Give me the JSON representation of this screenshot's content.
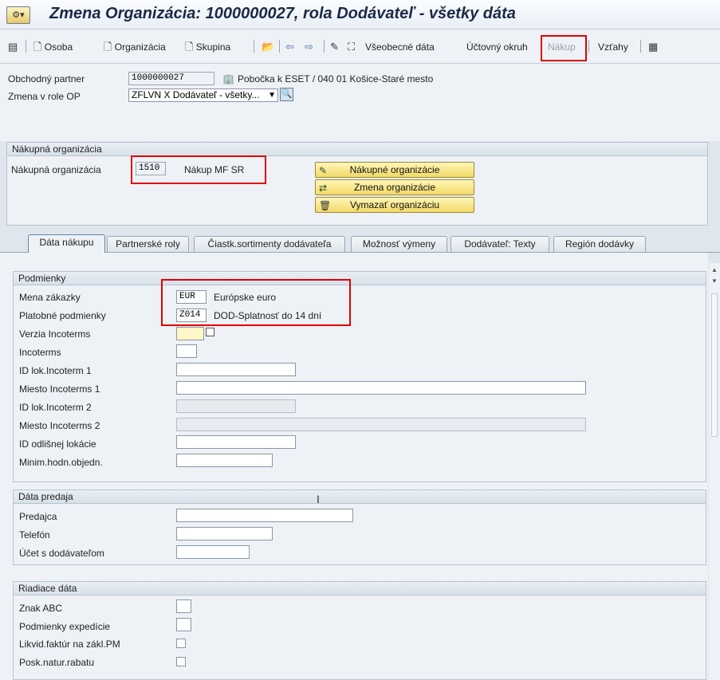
{
  "window": {
    "title": "Zmena Organizácia: 1000000027, rola Dodávateľ - všetky dáta",
    "icon": "sap-transaction-icon"
  },
  "toolbar": {
    "items": [
      {
        "name": "toggle-icon",
        "label": ""
      },
      {
        "name": "osoba",
        "label": "Osoba"
      },
      {
        "name": "organizacia",
        "label": "Organizácia"
      },
      {
        "name": "skupina",
        "label": "Skupina"
      },
      {
        "name": "vseobecne",
        "label": "Všeobecné dáta"
      },
      {
        "name": "uctovny",
        "label": "Účtovný okruh"
      },
      {
        "name": "nakup",
        "label": "Nákup"
      },
      {
        "name": "vztahy",
        "label": "Vzťahy"
      }
    ]
  },
  "header": {
    "partner_label": "Obchodný partner",
    "partner_value": "1000000027",
    "partner_desc": "Pobočka k ESET / 040 01 Košice-Staré mesto",
    "role_label": "Zmena v role OP",
    "role_value": "ZFLVN X Dodávateľ - všetky..."
  },
  "purch_org": {
    "group_title": "Nákupná organizácia",
    "label": "Nákupná organizácia",
    "code": "1510",
    "name": "Nákup MF SR",
    "buttons": {
      "orgs": "Nákupné organizácie",
      "change": "Zmena organizácie",
      "delete": "Vymazať organizáciu"
    }
  },
  "tabs": [
    {
      "label": "Dáta nákupu",
      "active": true
    },
    {
      "label": "Partnerské roly",
      "active": false
    },
    {
      "label": "Čiastk.sortimenty dodávateľa",
      "active": false
    },
    {
      "label": "Možnosť výmeny",
      "active": false
    },
    {
      "label": "Dodávateľ: Texty",
      "active": false
    },
    {
      "label": "Región dodávky",
      "active": false
    }
  ],
  "conditions": {
    "title": "Podmienky",
    "currency_label": "Mena zákazky",
    "currency_value": "EUR",
    "currency_desc": "Európske euro",
    "payment_label": "Platobné podmienky",
    "payment_value": "Z014",
    "payment_desc": "DOD-Splatnosť do 14 dní",
    "incoterms_version_label": "Verzia Incoterms",
    "incoterms_label": "Incoterms",
    "loc_id1_label": "ID lok.Incoterm 1",
    "place1_label": "Miesto Incoterms 1",
    "loc_id2_label": "ID lok.Incoterm 2",
    "place2_label": "Miesto Incoterms 2",
    "diff_loc_label": "ID odlišnej lokácie",
    "min_value_label": "Minim.hodn.objedn."
  },
  "sales_data": {
    "title": "Dáta predaja",
    "seller_label": "Predajca",
    "phone_label": "Telefón",
    "account_label": "Účet s dodávateľom"
  },
  "control_data": {
    "title": "Riadiace dáta",
    "abc_label": "Znak ABC",
    "shipping_label": "Podmienky expedície",
    "gr_invoice_label": "Likvid.faktúr na zákl.PM",
    "natural_discount_label": "Posk.natur.rabatu"
  }
}
